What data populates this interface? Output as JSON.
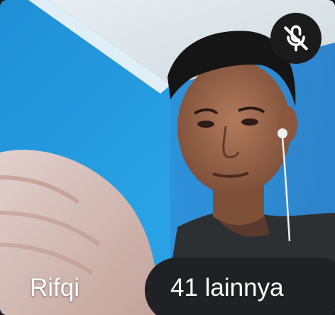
{
  "participant": {
    "name": "Rifqi",
    "mic_state": "muted",
    "mute_icon": "mic-off-icon"
  },
  "overflow": {
    "label": "41 lainnya"
  },
  "colors": {
    "wall": "#2a9be0",
    "ceiling": "#dfe8ee",
    "pill_bg": "#202124",
    "mute_bg": "#1b1b1b",
    "text": "#ffffff"
  }
}
